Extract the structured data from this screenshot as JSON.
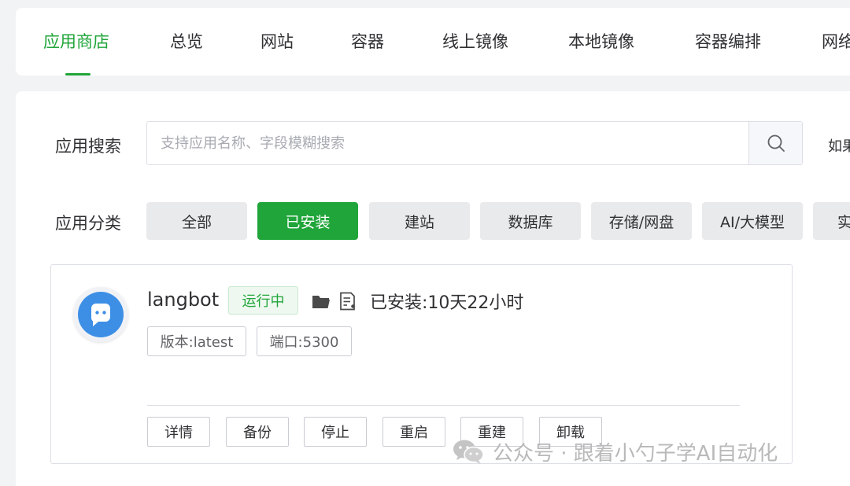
{
  "tabs": [
    {
      "label": "应用商店",
      "active": true
    },
    {
      "label": "总览",
      "active": false
    },
    {
      "label": "网站",
      "active": false
    },
    {
      "label": "容器",
      "active": false
    },
    {
      "label": "线上镜像",
      "active": false
    },
    {
      "label": "本地镜像",
      "active": false
    },
    {
      "label": "容器编排",
      "active": false
    },
    {
      "label": "网络",
      "active": false
    }
  ],
  "search": {
    "label": "应用搜索",
    "placeholder": "支持应用名称、字段模糊搜索",
    "value": "",
    "hint": "如果"
  },
  "categories": {
    "label": "应用分类",
    "items": [
      {
        "label": "全部",
        "active": false
      },
      {
        "label": "已安装",
        "active": true
      },
      {
        "label": "建站",
        "active": false
      },
      {
        "label": "数据库",
        "active": false
      },
      {
        "label": "存储/网盘",
        "active": false
      },
      {
        "label": "AI/大模型",
        "active": false
      },
      {
        "label": "实用",
        "active": false
      }
    ]
  },
  "app": {
    "name": "langbot",
    "status": "运行中",
    "installed": "已安装:10天22小时",
    "version": "版本:latest",
    "port": "端口:5300",
    "icons": [
      "folder-icon",
      "log-icon"
    ],
    "actions": [
      "详情",
      "备份",
      "停止",
      "重启",
      "重建",
      "卸载"
    ]
  },
  "watermark": {
    "text": "公众号 · 跟着小勺子学AI自动化"
  },
  "colors": {
    "accent": "#20a53a",
    "avatar_blue": "#3d8fe6",
    "background": "#f2f3f5"
  }
}
